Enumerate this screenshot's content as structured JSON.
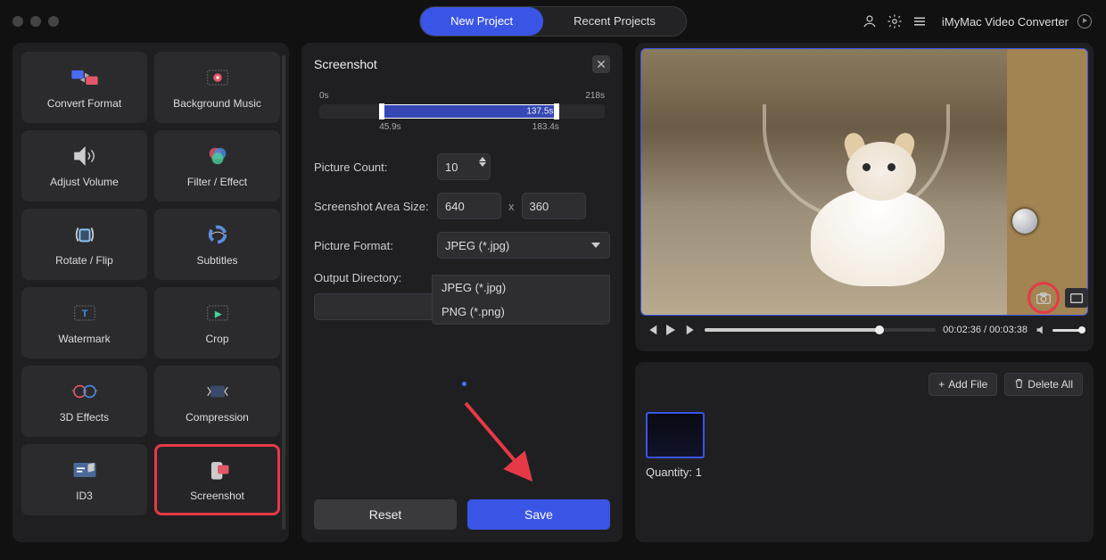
{
  "app": {
    "title": "iMyMac Video Converter"
  },
  "menu": {
    "new_project": "New Project",
    "recent_projects": "Recent Projects"
  },
  "tools": {
    "convert": "Convert Format",
    "bgmusic": "Background Music",
    "volume": "Adjust Volume",
    "filter": "Filter / Effect",
    "rotate": "Rotate / Flip",
    "subtitles": "Subtitles",
    "watermark": "Watermark",
    "crop": "Crop",
    "effects3d": "3D Effects",
    "compression": "Compression",
    "id3": "ID3",
    "screenshot": "Screenshot"
  },
  "panel": {
    "title": "Screenshot",
    "slider": {
      "start_tick": "0s",
      "end_tick": "218s",
      "in_point": "45.9s",
      "out_point": "183.4s",
      "current": "137.5s"
    },
    "labels": {
      "picture_count": "Picture Count:",
      "area_size": "Screenshot Area Size:",
      "format": "Picture Format:",
      "output_dir": "Output Directory:"
    },
    "picture_count": "10",
    "width": "640",
    "height": "360",
    "x": "x",
    "format_selected": "JPEG (*.jpg)",
    "format_options": [
      "JPEG (*.jpg)",
      "PNG (*.png)"
    ],
    "reset": "Reset",
    "save": "Save"
  },
  "player": {
    "current": "00:02:36",
    "total": "00:03:38",
    "sep": " / "
  },
  "files": {
    "add_file": "Add File",
    "delete_all": "Delete All",
    "quantity_label": "Quantity:",
    "quantity": "1"
  }
}
